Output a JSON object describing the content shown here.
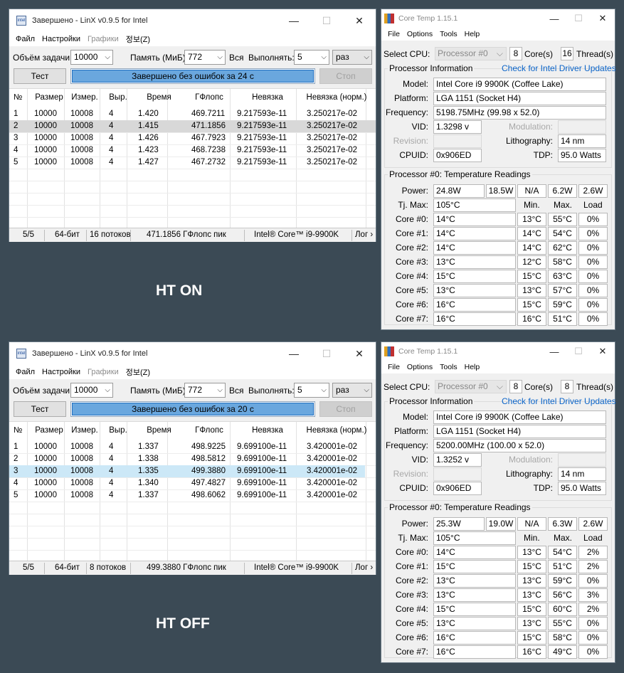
{
  "labels": {
    "ht_on": "HT ON",
    "ht_off": "HT OFF"
  },
  "linx": {
    "title": "Завершено - LinX v0.9.5 for Intel",
    "app_icon_text": "intel",
    "menu": [
      "Файл",
      "Настройки",
      "Графики",
      "정보(Z)"
    ],
    "problem_size_label": "Объём задачи:",
    "problem_size": "10000",
    "memory_label": "Память (МиБ):",
    "memory": "772",
    "all_label": "Вся",
    "run_label": "Выполнять:",
    "run_count": "5",
    "run_unit": "раз",
    "test_button": "Тест",
    "stop_button": "Стоп",
    "columns": [
      "№",
      "Размер",
      "Измер.",
      "Выр.",
      "Время",
      "ГФлопс",
      "Невязка",
      "Невязка (норм.)"
    ],
    "instances": [
      {
        "progress_text": "Завершено без ошибок за 24 с",
        "rows": [
          [
            "1",
            "10000",
            "10008",
            "4",
            "1.420",
            "469.7211",
            "9.217593e-11",
            "3.250217e-02"
          ],
          [
            "2",
            "10000",
            "10008",
            "4",
            "1.415",
            "471.1856",
            "9.217593e-11",
            "3.250217e-02"
          ],
          [
            "3",
            "10000",
            "10008",
            "4",
            "1.426",
            "467.7923",
            "9.217593e-11",
            "3.250217e-02"
          ],
          [
            "4",
            "10000",
            "10008",
            "4",
            "1.423",
            "468.7238",
            "9.217593e-11",
            "3.250217e-02"
          ],
          [
            "5",
            "10000",
            "10008",
            "4",
            "1.427",
            "467.2732",
            "9.217593e-11",
            "3.250217e-02"
          ]
        ],
        "status": {
          "runs": "5/5",
          "bits": "64-бит",
          "threads": "16 потоков",
          "peak": "471.1856 ГФлопс пик",
          "cpu": "Intel® Core™ i9-9900K",
          "log": "Лог ›"
        }
      },
      {
        "progress_text": "Завершено без ошибок за 20 с",
        "rows": [
          [
            "1",
            "10000",
            "10008",
            "4",
            "1.337",
            "498.9225",
            "9.699100e-11",
            "3.420001e-02"
          ],
          [
            "2",
            "10000",
            "10008",
            "4",
            "1.338",
            "498.5812",
            "9.699100e-11",
            "3.420001e-02"
          ],
          [
            "3",
            "10000",
            "10008",
            "4",
            "1.335",
            "499.3880",
            "9.699100e-11",
            "3.420001e-02"
          ],
          [
            "4",
            "10000",
            "10008",
            "4",
            "1.340",
            "497.4827",
            "9.699100e-11",
            "3.420001e-02"
          ],
          [
            "5",
            "10000",
            "10008",
            "4",
            "1.337",
            "498.6062",
            "9.699100e-11",
            "3.420001e-02"
          ]
        ],
        "status": {
          "runs": "5/5",
          "bits": "64-бит",
          "threads": "8 потоков",
          "peak": "499.3880 ГФлопс пик",
          "cpu": "Intel® Core™ i9-9900K",
          "log": "Лог ›"
        }
      }
    ]
  },
  "coretemp": {
    "title": "Core Temp 1.15.1",
    "menu": [
      "File",
      "Options",
      "Tools",
      "Help"
    ],
    "select_cpu_label": "Select CPU:",
    "cpu_select": "Processor #0",
    "cores_label": "Core(s)",
    "threads_label": "Thread(s)",
    "proc_info_title": "Processor Information",
    "driver_link": "Check for Intel Driver Updates",
    "model_label": "Model:",
    "platform_label": "Platform:",
    "frequency_label": "Frequency:",
    "vid_label": "VID:",
    "modulation_label": "Modulation:",
    "revision_label": "Revision:",
    "lithography_label": "Lithography:",
    "cpuid_label": "CPUID:",
    "tdp_label": "TDP:",
    "temp_title": "Processor #0: Temperature Readings",
    "power_label": "Power:",
    "tjmax_label": "Tj. Max:",
    "min_label": "Min.",
    "max_label": "Max.",
    "load_label": "Load",
    "instances": [
      {
        "cores": "8",
        "threads": "16",
        "model": "Intel Core i9 9900K (Coffee Lake)",
        "platform": "LGA 1151 (Socket H4)",
        "frequency": "5198.75MHz (99.98 x 52.0)",
        "vid": "1.3298 v",
        "lithography": "14 nm",
        "cpuid": "0x906ED",
        "tdp": "95.0 Watts",
        "power": [
          "24.8W",
          "18.5W",
          "N/A",
          "6.2W",
          "2.6W"
        ],
        "tjmax": "105°C",
        "core_rows": [
          [
            "Core #0:",
            "14°C",
            "13°C",
            "55°C",
            "0%"
          ],
          [
            "Core #1:",
            "14°C",
            "14°C",
            "54°C",
            "0%"
          ],
          [
            "Core #2:",
            "14°C",
            "14°C",
            "62°C",
            "0%"
          ],
          [
            "Core #3:",
            "13°C",
            "12°C",
            "58°C",
            "0%"
          ],
          [
            "Core #4:",
            "15°C",
            "15°C",
            "63°C",
            "0%"
          ],
          [
            "Core #5:",
            "13°C",
            "13°C",
            "57°C",
            "0%"
          ],
          [
            "Core #6:",
            "16°C",
            "15°C",
            "59°C",
            "0%"
          ],
          [
            "Core #7:",
            "16°C",
            "16°C",
            "51°C",
            "0%"
          ]
        ]
      },
      {
        "cores": "8",
        "threads": "8",
        "model": "Intel Core i9 9900K (Coffee Lake)",
        "platform": "LGA 1151 (Socket H4)",
        "frequency": "5200.00MHz (100.00 x 52.0)",
        "vid": "1.3252 v",
        "lithography": "14 nm",
        "cpuid": "0x906ED",
        "tdp": "95.0 Watts",
        "power": [
          "25.3W",
          "19.0W",
          "N/A",
          "6.3W",
          "2.6W"
        ],
        "tjmax": "105°C",
        "core_rows": [
          [
            "Core #0:",
            "14°C",
            "13°C",
            "54°C",
            "2%"
          ],
          [
            "Core #1:",
            "15°C",
            "15°C",
            "51°C",
            "2%"
          ],
          [
            "Core #2:",
            "13°C",
            "13°C",
            "59°C",
            "0%"
          ],
          [
            "Core #3:",
            "13°C",
            "13°C",
            "56°C",
            "3%"
          ],
          [
            "Core #4:",
            "15°C",
            "15°C",
            "60°C",
            "2%"
          ],
          [
            "Core #5:",
            "13°C",
            "13°C",
            "55°C",
            "0%"
          ],
          [
            "Core #6:",
            "16°C",
            "15°C",
            "58°C",
            "0%"
          ],
          [
            "Core #7:",
            "16°C",
            "16°C",
            "49°C",
            "0%"
          ]
        ]
      }
    ]
  }
}
